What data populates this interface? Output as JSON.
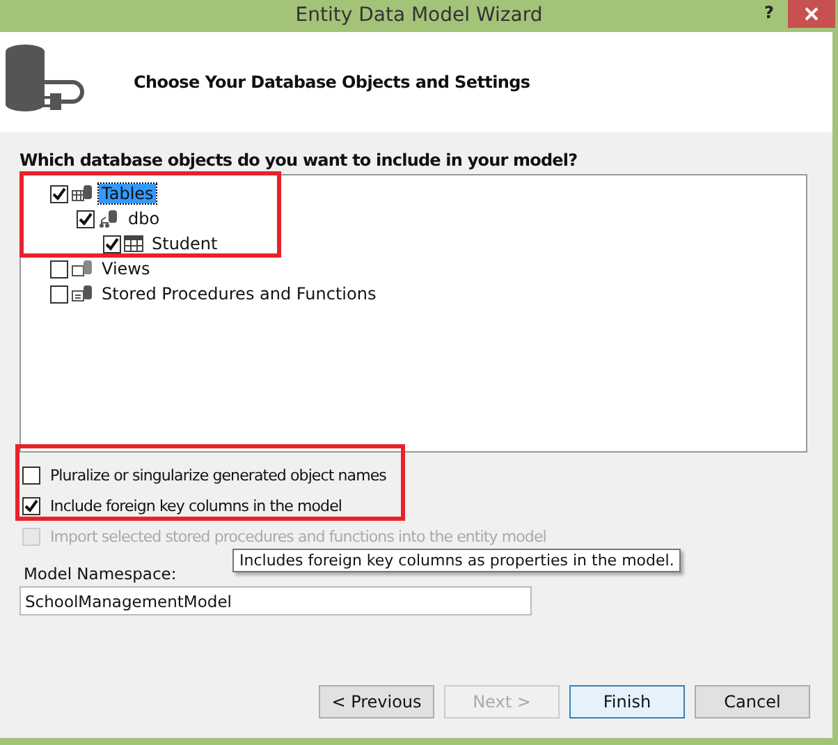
{
  "window": {
    "title": "Entity Data Model Wizard",
    "help": "?"
  },
  "header": {
    "title": "Choose Your Database Objects and Settings"
  },
  "question": "Which database objects do you want to include in your model?",
  "tree": [
    {
      "label": "Tables",
      "kind": "tables",
      "checked": true,
      "selected": true,
      "children": [
        {
          "label": "dbo",
          "kind": "schema",
          "checked": true,
          "selected": false,
          "children": [
            {
              "label": "Student",
              "kind": "table",
              "checked": true,
              "selected": false
            }
          ]
        }
      ]
    },
    {
      "label": "Views",
      "kind": "views",
      "checked": false,
      "selected": false
    },
    {
      "label": "Stored Procedures and Functions",
      "kind": "procedures",
      "checked": false,
      "selected": false
    }
  ],
  "options": [
    {
      "label": "Pluralize or singularize generated object names",
      "checked": false,
      "disabled": false
    },
    {
      "label": "Include foreign key columns in the model",
      "checked": true,
      "disabled": false
    },
    {
      "label": "Import selected stored procedures and functions into the entity model",
      "checked": false,
      "disabled": true
    }
  ],
  "tooltip": "Includes foreign key columns as properties in the model.",
  "namespace": {
    "label": "Model Namespace:",
    "value": "SchoolManagementModel"
  },
  "buttons": [
    {
      "label": "< Previous",
      "disabled": false,
      "default": false
    },
    {
      "label": "Next >",
      "disabled": true,
      "default": false
    },
    {
      "label": "Finish",
      "disabled": false,
      "default": true
    },
    {
      "label": "Cancel",
      "disabled": false,
      "default": false
    }
  ]
}
